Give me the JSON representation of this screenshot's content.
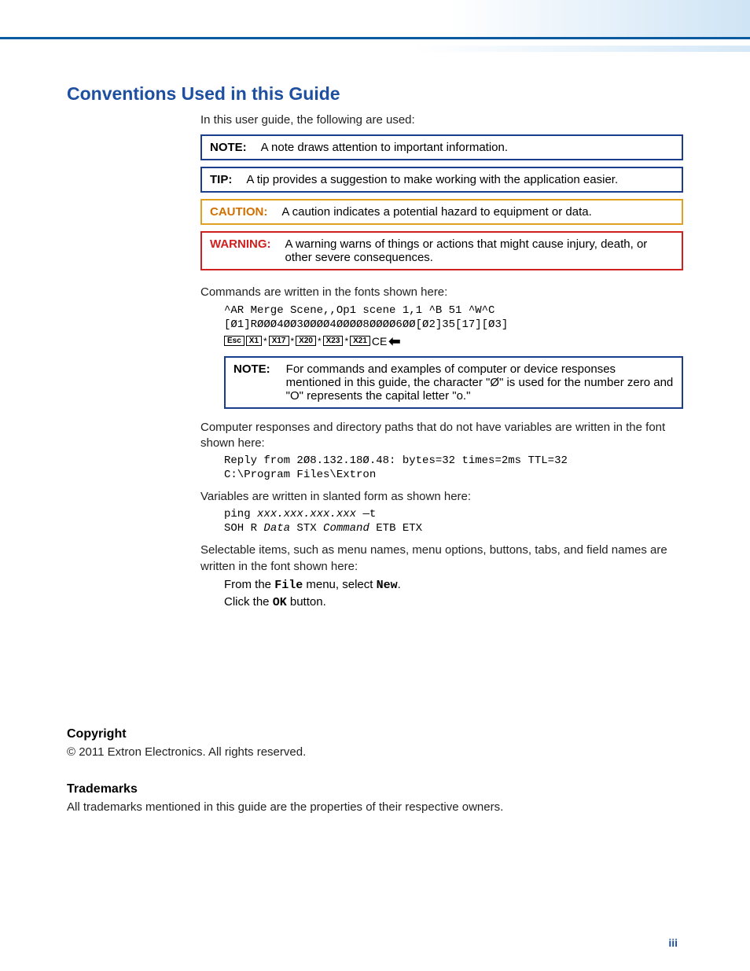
{
  "title": "Conventions Used in this Guide",
  "intro": "In this user guide, the following are used:",
  "callouts": {
    "note": {
      "label": "NOTE:",
      "text": "A note draws attention to important information."
    },
    "tip": {
      "label": "TIP:",
      "text": "A tip provides a suggestion to make working with the application easier."
    },
    "caution": {
      "label": "CAUTION:",
      "text": "A caution indicates a potential hazard to equipment or data."
    },
    "warning": {
      "label": "WARNING:",
      "text": "A warning warns of things or actions that might cause injury, death, or other severe consequences."
    }
  },
  "commands_intro": "Commands are written in the fonts shown here:",
  "cmd_line1": "^AR Merge Scene,,Op1 scene 1,1 ^B 51 ^W^C",
  "cmd_line2": "[Ø1]RØØØ4ØØ3ØØØØ4ØØØØ8ØØØØ6ØØ[Ø2]35[17][Ø3]",
  "keys": {
    "esc": "Esc",
    "x1": "X1",
    "x17": "X17",
    "x20": "X20",
    "x23": "X23",
    "x21": "X21",
    "ce": "CE"
  },
  "note_inner": {
    "label": "NOTE:",
    "text": "For commands and examples of computer or device responses mentioned in this guide, the character \"Ø\" is used for the number zero and \"O\" represents the capital letter \"o.\""
  },
  "resp_intro": "Computer responses and directory paths that do not have variables are written in the font shown here:",
  "resp_line1": "Reply from 2Ø8.132.18Ø.48: bytes=32 times=2ms TTL=32",
  "resp_line2": "C:\\Program Files\\Extron",
  "vars_intro": "Variables are written in slanted form as shown here:",
  "vars_line1_pre": "ping ",
  "vars_line1_var": "xxx.xxx.xxx.xxx",
  "vars_line1_post": " —t",
  "vars_line2_a": "SOH R ",
  "vars_line2_b": "Data",
  "vars_line2_c": " STX ",
  "vars_line2_d": "Command",
  "vars_line2_e": " ETB ETX",
  "select_intro": "Selectable items, such as menu names, menu options, buttons, tabs, and field names are written in the font shown here:",
  "select_line1_a": "From the ",
  "select_line1_b": "File",
  "select_line1_c": " menu, select ",
  "select_line1_d": "New",
  "select_line1_e": ".",
  "select_line2_a": "Click the ",
  "select_line2_b": "OK",
  "select_line2_c": " button.",
  "copyright": {
    "heading": "Copyright",
    "text": "© 2011  Extron Electronics. All rights reserved."
  },
  "trademarks": {
    "heading": "Trademarks",
    "text": "All trademarks mentioned in this guide are the properties of their respective owners."
  },
  "page_num": "iii"
}
